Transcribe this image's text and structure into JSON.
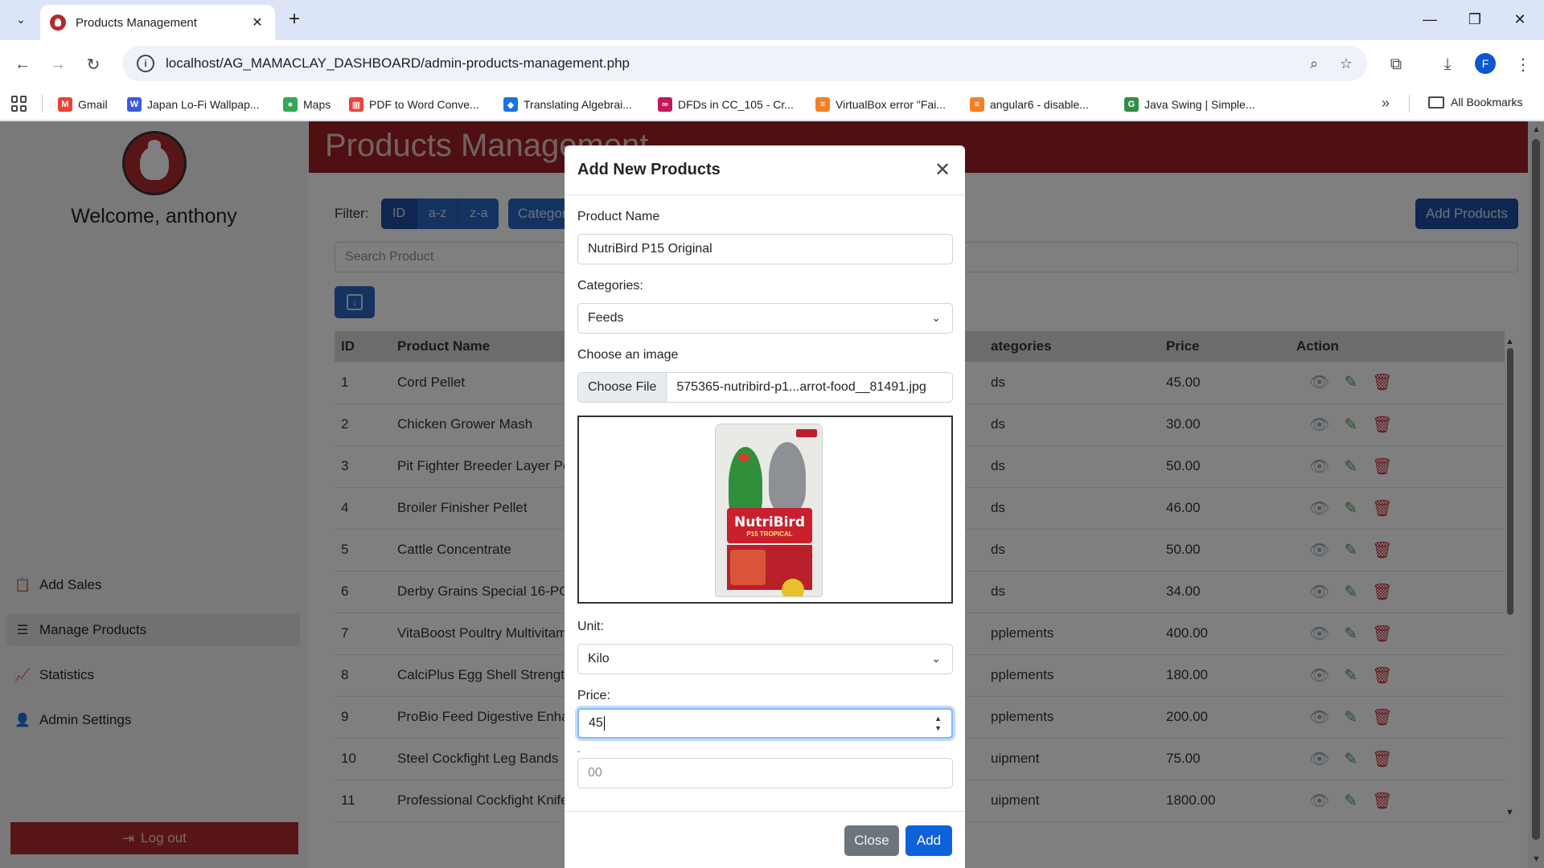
{
  "browser": {
    "tab_title": "Products Management",
    "url": "localhost/AG_MAMACLAY_DASHBOARD/admin-products-management.php",
    "profile_initial": "F",
    "bookmarks": [
      {
        "label": "Gmail",
        "color": "#ea4335",
        "icon": "M"
      },
      {
        "label": "Japan Lo-Fi Wallpap...",
        "color": "#3b5bdb",
        "icon": "W"
      },
      {
        "label": "Maps",
        "color": "#34a853",
        "icon": "●"
      },
      {
        "label": "PDF to Word Conve...",
        "color": "#e8453c",
        "icon": "▦"
      },
      {
        "label": "Translating Algebrai...",
        "color": "#1a73e8",
        "icon": "◆"
      },
      {
        "label": "DFDs in CC_105 - Cr...",
        "color": "#c2185b",
        "icon": "∞"
      },
      {
        "label": "VirtualBox error \"Fai...",
        "color": "#f48024",
        "icon": "≡"
      },
      {
        "label": "angular6 - disable...",
        "color": "#f48024",
        "icon": "≡"
      },
      {
        "label": "Java Swing | Simple...",
        "color": "#2f8d46",
        "icon": "G"
      }
    ],
    "all_bookmarks": "All Bookmarks"
  },
  "sidebar": {
    "welcome": "Welcome, anthony",
    "items": [
      {
        "label": "Add Sales",
        "icon": "clipboard-check-icon"
      },
      {
        "label": "Manage Products",
        "icon": "list-icon"
      },
      {
        "label": "Statistics",
        "icon": "chart-icon"
      },
      {
        "label": "Admin Settings",
        "icon": "user-icon"
      }
    ],
    "logout": "Log out"
  },
  "main": {
    "title": "Products Management",
    "filter_label": "Filter:",
    "filters": [
      "ID",
      "a-z",
      "z-a"
    ],
    "category_button": "Categor",
    "add_products": "Add Products",
    "search_placeholder": "Search Product",
    "table": {
      "headers": [
        "ID",
        "Product Name",
        "ategories",
        "Price",
        "Action"
      ],
      "rows": [
        {
          "id": "1",
          "name": "Cord Pellet",
          "category": "ds",
          "price": "45.00"
        },
        {
          "id": "2",
          "name": "Chicken Grower Mash",
          "category": "ds",
          "price": "30.00"
        },
        {
          "id": "3",
          "name": "Pit Fighter Breeder Layer Pe",
          "category": "ds",
          "price": "50.00"
        },
        {
          "id": "4",
          "name": "Broiler Finisher Pellet",
          "category": "ds",
          "price": "46.00"
        },
        {
          "id": "5",
          "name": "Cattle Concentrate",
          "category": "ds",
          "price": "50.00"
        },
        {
          "id": "6",
          "name": "Derby Grains Special 16-PO",
          "category": "ds",
          "price": "34.00"
        },
        {
          "id": "7",
          "name": "VitaBoost Poultry Multivitam",
          "category": "pplements",
          "price": "400.00"
        },
        {
          "id": "8",
          "name": "CalciPlus Egg Shell Strength",
          "category": "pplements",
          "price": "180.00"
        },
        {
          "id": "9",
          "name": "ProBio Feed Digestive Enhar",
          "category": "pplements",
          "price": "200.00"
        },
        {
          "id": "10",
          "name": "Steel Cockfight Leg Bands",
          "category": "uipment",
          "price": "75.00"
        },
        {
          "id": "11",
          "name": "Professional Cockfight Knife",
          "category": "uipment",
          "price": "1800.00"
        }
      ]
    }
  },
  "modal": {
    "title": "Add New Products",
    "product_name_label": "Product Name",
    "product_name_value": "NutriBird P15 Original",
    "categories_label": "Categories:",
    "categories_value": "Feeds",
    "image_label": "Choose an image",
    "choose_file": "Choose File",
    "file_name": "575365-nutribird-p1...arrot-food__81491.jpg",
    "preview_brand": "NutriBird",
    "preview_sub": "P15 TROPICAL",
    "unit_label": "Unit:",
    "unit_value": "Kilo",
    "price_label": "Price:",
    "price_value": "45",
    "decimal_label": ".",
    "decimal_placeholder": "00",
    "close_button": "Close",
    "add_button": "Add"
  }
}
